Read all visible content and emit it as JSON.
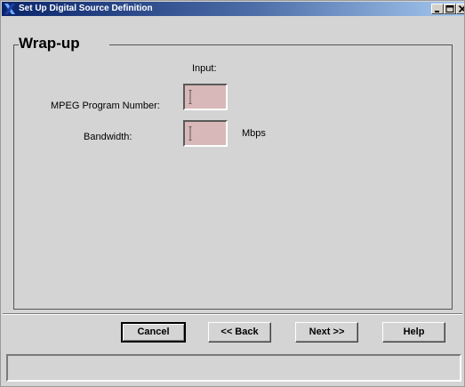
{
  "window": {
    "title": "Set Up Digital Source Definition",
    "icon": "x-window-icon",
    "controls": [
      "minimize-icon",
      "maximize-icon",
      "close-icon"
    ]
  },
  "panel": {
    "title": "Wrap-up",
    "column_header": "Input:",
    "fields": [
      {
        "label": "MPEG Program Number:",
        "value": "",
        "unit": ""
      },
      {
        "label": "Bandwidth:",
        "value": "",
        "unit": "Mbps"
      }
    ]
  },
  "buttons": {
    "cancel": "Cancel",
    "back": "<< Back",
    "next": "Next >>",
    "help": "Help"
  },
  "status": {
    "text": ""
  },
  "colors": {
    "title_bar_start": "#0a246a",
    "title_bar_end": "#a6caf0",
    "window_bg": "#d4d4d4",
    "input_bg": "#d8b8b8"
  }
}
